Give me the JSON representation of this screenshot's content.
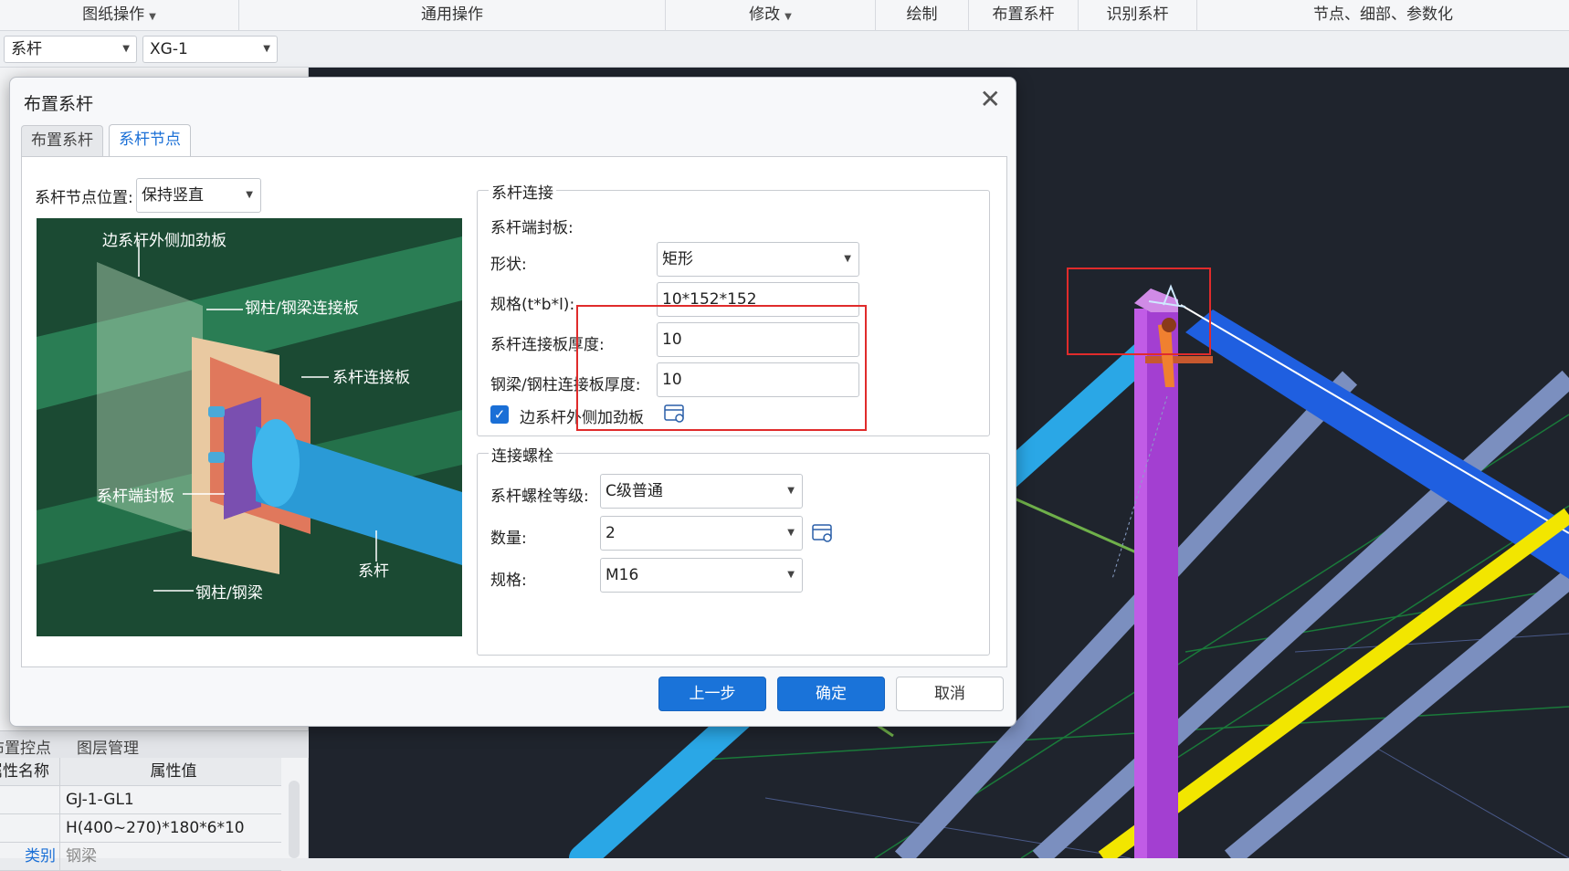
{
  "ribbon": {
    "groups": [
      {
        "label": "图纸操作",
        "dropdown": true
      },
      {
        "label": "通用操作",
        "dropdown": false
      },
      {
        "label": "修改",
        "dropdown": true
      },
      {
        "label": "绘制",
        "dropdown": false
      },
      {
        "label": "布置系杆",
        "dropdown": false
      },
      {
        "label": "识别系杆",
        "dropdown": false
      },
      {
        "label": "节点、细部、参数化",
        "dropdown": false
      }
    ]
  },
  "toolbar": {
    "component_type": "系杆",
    "component_name": "XG-1"
  },
  "left_panel": {
    "bottom_tabs": [
      "布置控点",
      "图层管理"
    ],
    "table_headers": [
      "属性名称",
      "属性值"
    ],
    "rows": [
      {
        "name": "",
        "value": "GJ-1-GL1"
      },
      {
        "name": "",
        "value": "H(400~270)*180*6*10"
      },
      {
        "name": "类别",
        "value": "钢梁"
      }
    ]
  },
  "dialog": {
    "title": "布置系杆",
    "tabs": [
      "布置系杆",
      "系杆节点"
    ],
    "active_tab": 1,
    "node_position_label": "系杆节点位置:",
    "node_position_value": "保持竖直",
    "diagram_labels": {
      "stiffener": "边系杆外侧加劲板",
      "column_plate": "钢柱/钢梁连接板",
      "connect_plate": "系杆连接板",
      "end_plate": "系杆端封板",
      "tie_rod": "系杆",
      "column_beam": "钢柱/钢梁"
    },
    "connection": {
      "group_title": "系杆连接",
      "end_plate_label": "系杆端封板:",
      "shape_label": "形状:",
      "shape_value": "矩形",
      "spec_label": "规格(t*b*l):",
      "spec_value": "10*152*152",
      "plate_thickness_label": "系杆连接板厚度:",
      "plate_thickness_value": "10",
      "beam_plate_thickness_label": "钢梁/钢柱连接板厚度:",
      "beam_plate_thickness_value": "10",
      "stiffener_checkbox_label": "边系杆外侧加劲板",
      "stiffener_checked": true
    },
    "bolts": {
      "group_title": "连接螺栓",
      "grade_label": "系杆螺栓等级:",
      "grade_value": "C级普通",
      "count_label": "数量:",
      "count_value": "2",
      "spec_label": "规格:",
      "spec_value": "M16"
    },
    "buttons": {
      "prev": "上一步",
      "ok": "确定",
      "cancel": "取消"
    }
  },
  "colors": {
    "accent": "#1a73d9",
    "highlight_box": "#e02b2b",
    "viewport_bg": "#1f242d",
    "column": "#a33fd1",
    "beam_blue": "#1f5fe0",
    "tie_cyan": "#2aa7e6",
    "yellow_member": "#f2e600"
  }
}
